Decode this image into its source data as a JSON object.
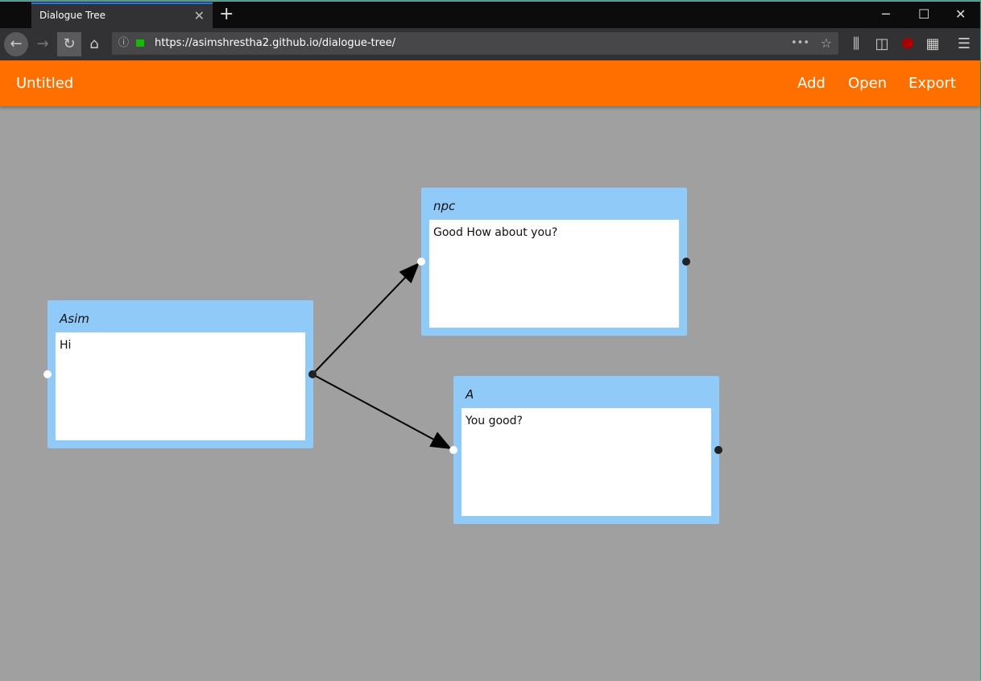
{
  "browser": {
    "tab_title": "Dialogue Tree",
    "url": "https://asimshrestha2.github.io/dialogue-tree/"
  },
  "app": {
    "title": "Untitled",
    "menu": [
      "Add",
      "Open",
      "Export"
    ]
  },
  "nodes": [
    {
      "speaker": "Asim",
      "text": "Hi"
    },
    {
      "speaker": "npc",
      "text": "Good How about you?"
    },
    {
      "speaker": "A",
      "text": "You good?"
    }
  ],
  "links": [
    {
      "from": "Asim",
      "to": "npc"
    },
    {
      "from": "Asim",
      "to": "A"
    }
  ],
  "colors": {
    "appbar": "#ff6f00",
    "node": "#90caf9",
    "canvas": "#a0a0a0"
  }
}
